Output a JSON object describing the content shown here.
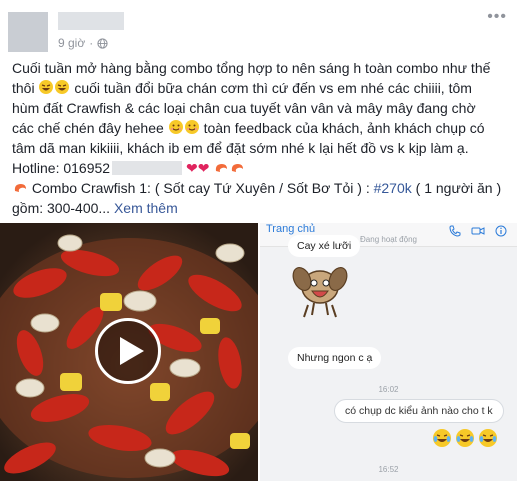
{
  "post": {
    "time": "9 giờ",
    "more": "•••",
    "text_lines": [
      "Cuối tuần mở hàng bằng combo tổng hợp to nên sáng h toàn combo như thế",
      "cuối tuần đổi bữa chán cơm thì cứ đến vs em nhé các chiiii, tôm",
      "hùm đất Crawfish & các loại chân cua tuyết vân vân và mây mây đang chờ",
      "các chế chén đây hehee",
      "toàn feedback của khách, ảnh khách chụp có",
      "tâm dã man kikiiii, khách ib em để đặt sớm nhé k lại hết đồ vs k kịp làm ạ.",
      "Hotline: 016952",
      "Combo Crawfish 1: ( Sốt cay Tứ Xuyên / Sốt Bơ Tỏi ) : ",
      " ( 1 người ăn )",
      "gồm: 300-400..."
    ],
    "line2_prefix": "thôi",
    "price_tag": "#270k",
    "see_more": "Xem thêm"
  },
  "chat": {
    "back_label": "Trang chủ",
    "status": "Đang hoạt động",
    "messages": {
      "m1": "Cay xé lưỡi",
      "m2": "Nhưng ngon c ạ",
      "m3": "có chụp dc kiểu ảnh nào cho t k"
    },
    "time1": "16:02",
    "time2": "16:52"
  },
  "icons": {
    "globe": "globe-icon",
    "play": "play-icon",
    "phone": "phone-icon",
    "video": "video-call-icon",
    "info": "info-icon"
  },
  "colors": {
    "link": "#385898",
    "hashtag": "#365899",
    "heart": "#e0245e",
    "chat_accent": "#2b7bd9"
  }
}
